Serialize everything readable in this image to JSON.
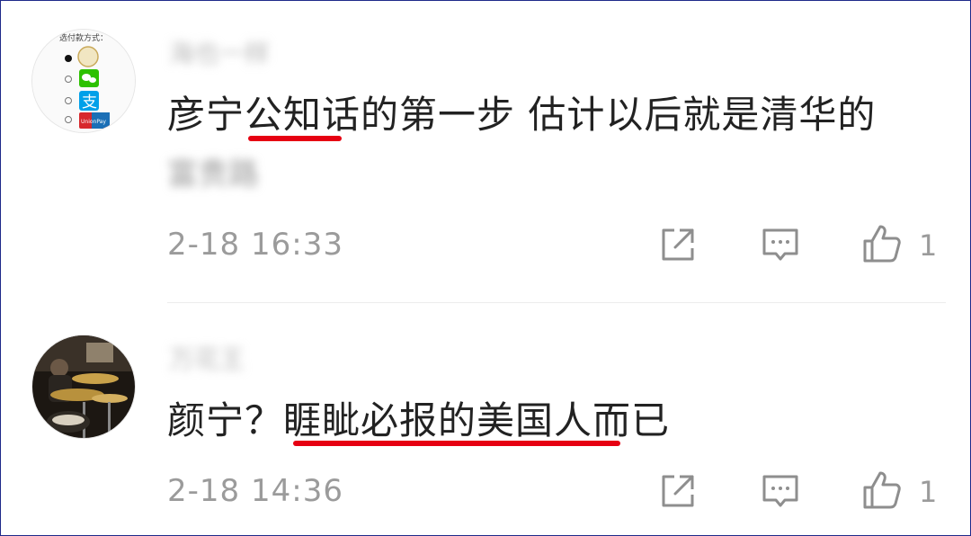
{
  "comments": [
    {
      "username": "海也一样",
      "line1": "彦宁公知话的第一步 估计以后就是清华的",
      "line2": "富贵路",
      "time": "2-18 16:33",
      "likes": "1",
      "avatar_caption": "选付款方式：",
      "avatar_card_label": "UnionPay"
    },
    {
      "username": "万花王",
      "line1": "颜宁？睚眦必报的美国人而已",
      "time": "2-18 14:36",
      "likes": "1"
    }
  ],
  "icons": [
    "share-icon",
    "comment-icon",
    "like-icon"
  ],
  "colors": {
    "underline": "#e60012",
    "text": "#222222",
    "muted": "#9b9b9b",
    "icon": "#8e8e8e"
  }
}
